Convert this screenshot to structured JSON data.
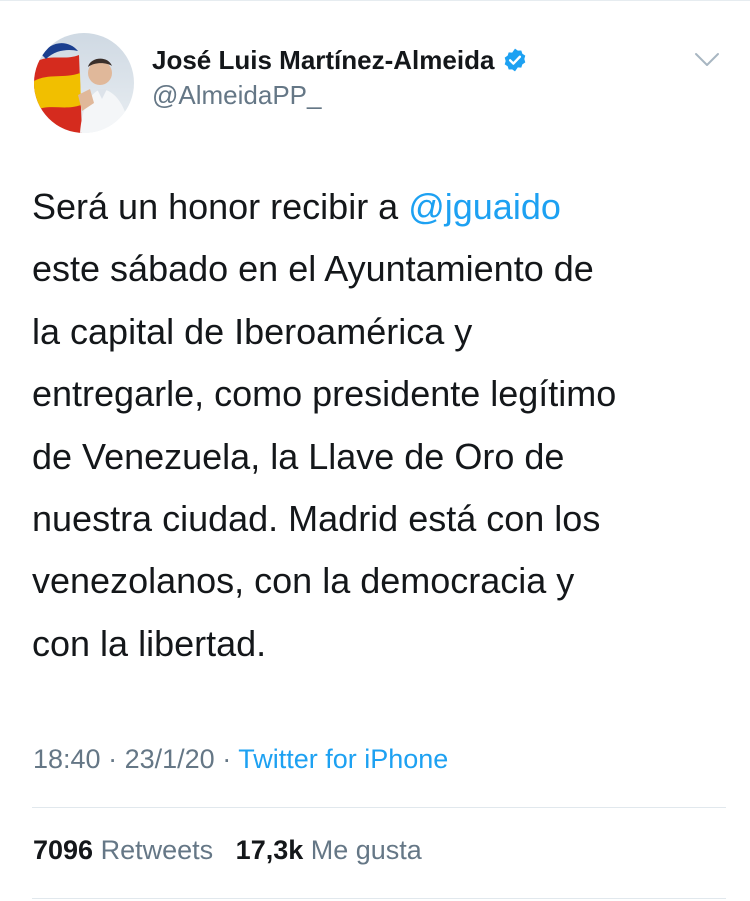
{
  "user": {
    "display_name": "José Luis Martínez-Almeida",
    "handle": "@AlmeidaPP_"
  },
  "tweet": {
    "text_before_mention": "Será un honor recibir a ",
    "mention": "@jguaido",
    "text_after_mention": "\neste sábado en el Ayuntamiento de\nla capital de Iberoamérica y\nentregarle, como presidente legítimo\nde Venezuela, la Llave de Oro de\nnuestra ciudad. Madrid está con los\nvenezolanos, con la democracia y\ncon la libertad."
  },
  "meta": {
    "time": "18:40",
    "separator": "·",
    "date": "23/1/20",
    "source": "Twitter for iPhone"
  },
  "stats": {
    "retweets_count": "7096",
    "retweets_label": "Retweets",
    "likes_count": "17,3k",
    "likes_label": "Me gusta"
  },
  "colors": {
    "link": "#1da1f2",
    "secondary": "#657786",
    "text": "#14171a",
    "verified": "#1da1f2"
  },
  "icons": [
    "avatar-photo",
    "verified-badge-icon",
    "chevron-down-icon"
  ]
}
